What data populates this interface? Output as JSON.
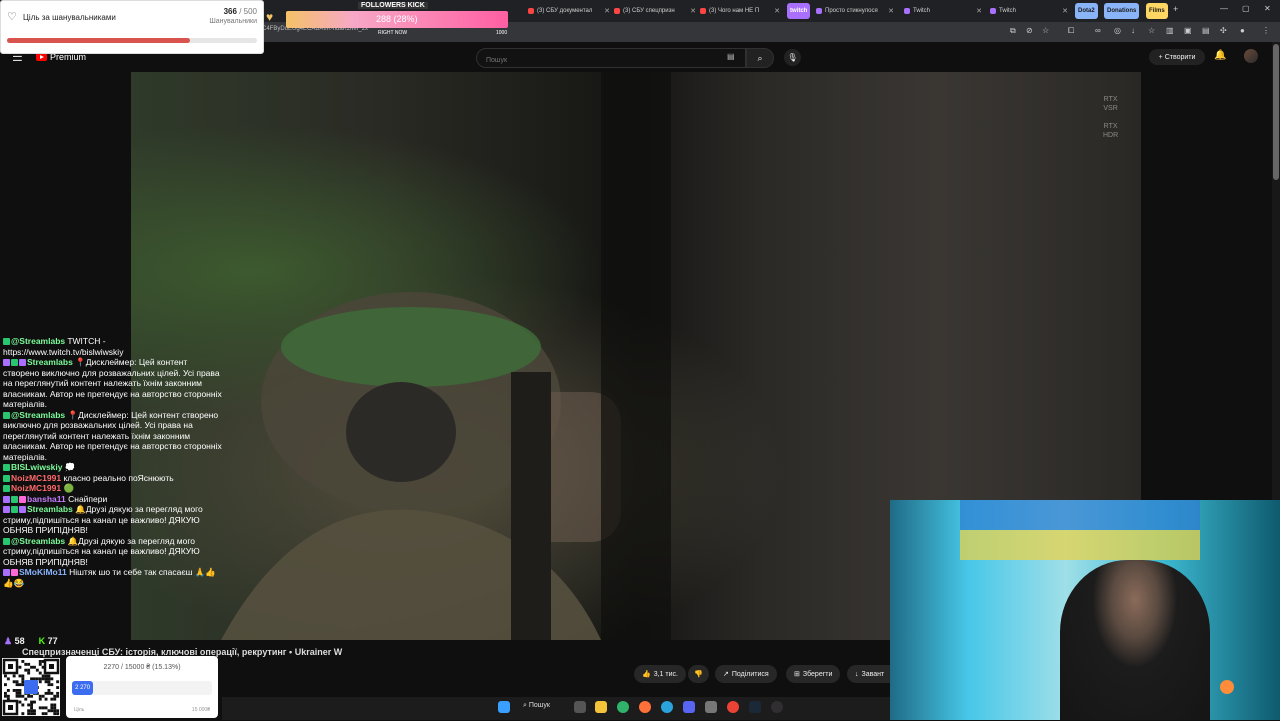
{
  "browser": {
    "tabs": [
      {
        "label": "(3) СБУ документал",
        "color": "#ff4444"
      },
      {
        "label": "(3) СБУ спецпризн",
        "color": "#ff4444"
      },
      {
        "label": "(3) Чого нам НЕ П",
        "color": "#ff4444"
      },
      {
        "label": "twitch",
        "color": "#a970ff"
      },
      {
        "label": "Просто стикнулося",
        "color": "#a970ff"
      },
      {
        "label": "Twitch",
        "color": "#a970ff"
      },
      {
        "label": "Twitch",
        "color": "#a970ff"
      }
    ],
    "pills": [
      {
        "label": "Dota2",
        "color": "#8ab4f8"
      },
      {
        "label": "Donations",
        "color": "#8ab4f8"
      },
      {
        "label": "Films",
        "color": "#fdd663"
      }
    ],
    "url": "C4FByDuEUg4ECABAIIK-ndaK2MII_2x"
  },
  "youtube": {
    "logo_text": "Premium",
    "search_placeholder": "Пошук",
    "create_label": "Створити",
    "video_title": "Спецпризначенці СБУ: історія, ключові операції, рекрутинг • Ukrainer W",
    "actions": [
      {
        "icon": "👍",
        "label": "3,1 тис."
      },
      {
        "icon": "👎",
        "label": ""
      },
      {
        "icon": "↗",
        "label": "Поділитися"
      },
      {
        "icon": "⊞",
        "label": "Зберегти"
      },
      {
        "icon": "↓",
        "label": "Завант"
      }
    ],
    "overlay_badge": "RTX VSR RTX HDR"
  },
  "follower_goal": {
    "label": "Ціль за шанувальниками",
    "current": "366",
    "total": "/ 500",
    "sub": "Шанувальники",
    "progress_fraction": 0.73
  },
  "followers_kick": {
    "title": "FOLLOWERS KICK",
    "value": "288 (28%)",
    "right_now": "RIGHT NOW",
    "max": "1000"
  },
  "chat": [
    {
      "name": "@Streamlabs",
      "name_color": "#7cfc9a",
      "badges": [
        "#28c76f"
      ],
      "text": "TWITCH - https://www.twitch.tv/bislwiwskiy"
    },
    {
      "name": "Streamlabs",
      "name_color": "#7cfc9a",
      "badges": [
        "#a970ff",
        "#28c76f",
        "#a970ff"
      ],
      "text": "📍Дисклеймер: Цей контент створено виключно для розважальних цілей. Усі права на переглянутий контент належать їхнім законним власникам. Автор не претендує на авторство сторонніх матеріалів."
    },
    {
      "name": "@Streamlabs",
      "name_color": "#7cfc9a",
      "badges": [
        "#28c76f"
      ],
      "text": "📍Дисклеймер: Цей контент створено виключно для розважальних цілей. Усі права на переглянутий контент належать їхнім законним власникам. Автор не претендує на авторство сторонніх матеріалів."
    },
    {
      "name": "BISLwiwskiy",
      "name_color": "#7cfc9a",
      "badges": [
        "#28c76f"
      ],
      "text": "💭"
    },
    {
      "name": "NoizMC1991",
      "name_color": "#ff6b6b",
      "badges": [
        "#28c76f"
      ],
      "text": "класно реально поЯснюють"
    },
    {
      "name": "NoizMC1991",
      "name_color": "#ff6b6b",
      "badges": [
        "#28c76f"
      ],
      "text": "🟢"
    },
    {
      "name": "bansha11",
      "name_color": "#c77dff",
      "badges": [
        "#a970ff",
        "#28c76f",
        "#ff6bd6"
      ],
      "text": "Снайпери"
    },
    {
      "name": "Streamlabs",
      "name_color": "#7cfc9a",
      "badges": [
        "#a970ff",
        "#28c76f",
        "#a970ff"
      ],
      "text": "🔔Друзі дякую за перегляд мого стриму,підпишіться на канал це важливо! ДЯКУЮ ОБНЯВ ПРИПІДНЯВ!"
    },
    {
      "name": "@Streamlabs",
      "name_color": "#7cfc9a",
      "badges": [
        "#28c76f"
      ],
      "text": "🔔Друзі дякую за перегляд мого стриму,підпишіться на канал це важливо! ДЯКУЮ ОБНЯВ ПРИПІДНЯВ!"
    },
    {
      "name": "SMoKiMo11",
      "name_color": "#8ab4ff",
      "badges": [
        "#a970ff",
        "#ff6bd6"
      ],
      "text": "Ніштяк шо ти себе так спасаєш 🙏👍👍😂"
    }
  ],
  "stream_stats": {
    "viewers": "58",
    "followers": "77"
  },
  "donation_goal": {
    "text": "2270 / 15000 ₴ (15.13%)",
    "fill_label": "2 270",
    "left": "Ціль",
    "right": "15 000₴",
    "progress_fraction": 0.1513
  },
  "taskbar": {
    "search_label": "Пошук",
    "icons": [
      "windows-icon",
      "search-icon",
      "task-view-icon",
      "explorer-icon",
      "edge-icon",
      "firefox-icon",
      "telegram-icon",
      "discord-icon",
      "store-icon",
      "chrome-icon",
      "steam-icon",
      "obs-icon"
    ]
  }
}
